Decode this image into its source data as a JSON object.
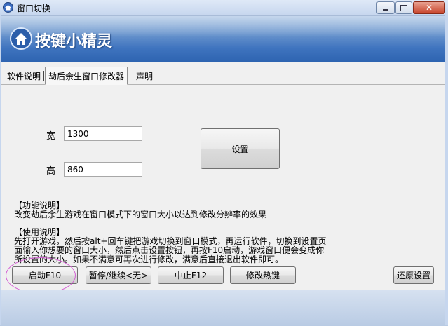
{
  "window": {
    "title": "窗口切换"
  },
  "banner": {
    "logo_text": "按键小精灵"
  },
  "tabs": [
    {
      "label": "软件说明"
    },
    {
      "label": "劫后余生窗口修改器"
    },
    {
      "label": "声明"
    }
  ],
  "form": {
    "width_label": "宽",
    "width_value": "1300",
    "height_label": "高",
    "height_value": "860",
    "set_button": "设置"
  },
  "description": {
    "function_heading": "【功能说明】",
    "function_text": "改变劫后余生游戏在窗口模式下的窗口大小以达到修改分辨率的效果",
    "usage_heading": "【使用说明】",
    "usage_lines": [
      "先打开游戏，然后按alt+回车键把游戏切换到窗口模式，再运行软件，切换到设置页",
      "面输入你想要的窗口大小，然后点击设置按钮，再按F10启动，游戏窗口便会变成你",
      "所设置的大小。如果不满意可再次进行修改，满意后直接退出软件即可。"
    ]
  },
  "buttons": {
    "start": "启动F10",
    "pause": "暂停/继续<无>",
    "stop": "中止F12",
    "hotkey": "修改热键",
    "restore": "还原设置"
  },
  "colors": {
    "banner": "#3f74bf",
    "highlight_ellipse": "#d45fd4"
  }
}
